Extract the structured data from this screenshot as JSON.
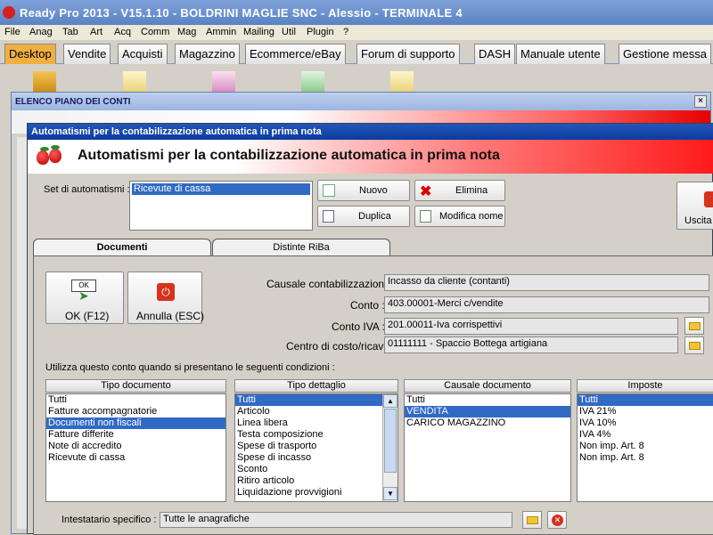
{
  "app": {
    "title": "Ready Pro 2013 - V15.1.10 - BOLDRINI MAGLIE SNC - Alessio - TERMINALE 4"
  },
  "menu": [
    "File",
    "Anag",
    "Tab",
    "Art",
    "Acq",
    "Comm",
    "Mag",
    "Ammin",
    "Mailing",
    "Util",
    "Plugin",
    "?"
  ],
  "tabs": [
    "Desktop",
    "Vendite",
    "Acquisti",
    "Magazzino",
    "Ecommerce/eBay",
    "Forum di supporto",
    "DASH",
    "Manuale utente",
    "Gestione messa"
  ],
  "elenco": {
    "title": "ELENCO PIANO DEI CONTI",
    "close": "×"
  },
  "dialog": {
    "window_title": "Automatismi per la contabilizzazione automatica in prima nota",
    "header_title": "Automatismi per la contabilizzazione automatica in prima nota",
    "set_label": "Set di automatismi :",
    "set_items": [
      "Ricevute di cassa"
    ],
    "buttons": {
      "nuovo": "Nuovo",
      "elimina": "Elimina",
      "duplica": "Duplica",
      "modifica": "Modifica nome",
      "uscita": "Uscita",
      "ok": "OK (F12)",
      "annulla": "Annulla (ESC)",
      "ok_icon_text": "OK"
    },
    "tabs": [
      "Documenti",
      "Distinte RiBa"
    ],
    "causale_label": "Causale contabilizzazione :",
    "causale_value": "Incasso da cliente (contanti)",
    "conto_label": "Conto :",
    "conto_value": "403.00001-Merci c/vendite",
    "contoiva_label": "Conto IVA :",
    "contoiva_value": "201.00011-Iva corrispettivi",
    "centro_label": "Centro di costo/ricavo :",
    "centro_value": "01111111 - Spaccio Bottega artigiana",
    "conditions_label": "Utilizza questo conto quando si presentano le seguenti condizioni :",
    "lists": {
      "tipo_documento": {
        "header": "Tipo documento",
        "items": [
          "Tutti",
          "Fatture accompagnatorie",
          "Documenti non fiscali",
          "Fatture differite",
          "Note di accredito",
          "Ricevute di cassa"
        ],
        "selected": 2
      },
      "tipo_dettaglio": {
        "header": "Tipo dettaglio",
        "items": [
          "Tutti",
          "Articolo",
          "Linea libera",
          "Testa composizione",
          "Spese di trasporto",
          "Spese di incasso",
          "Sconto",
          "Ritiro articolo",
          "Liquidazione provvigioni"
        ],
        "selected": 0
      },
      "causale_documento": {
        "header": "Causale documento",
        "items": [
          "Tutti",
          "VENDITA",
          "CARICO MAGAZZINO"
        ],
        "selected": 1
      },
      "imposte": {
        "header": "Imposte",
        "items": [
          "Tutti",
          "IVA 21%",
          "IVA 10%",
          "IVA 4%",
          "Non imp. Art. 8",
          "Non imp. Art. 8"
        ],
        "selected": 0
      }
    },
    "intestatario_label": "Intestatario specifico :",
    "intestatario_value": "Tutte le anagrafiche"
  },
  "colors": {
    "selection": "#316ac5",
    "active_tab": "#f0b040",
    "dialog_title": "#0c3ba0"
  }
}
